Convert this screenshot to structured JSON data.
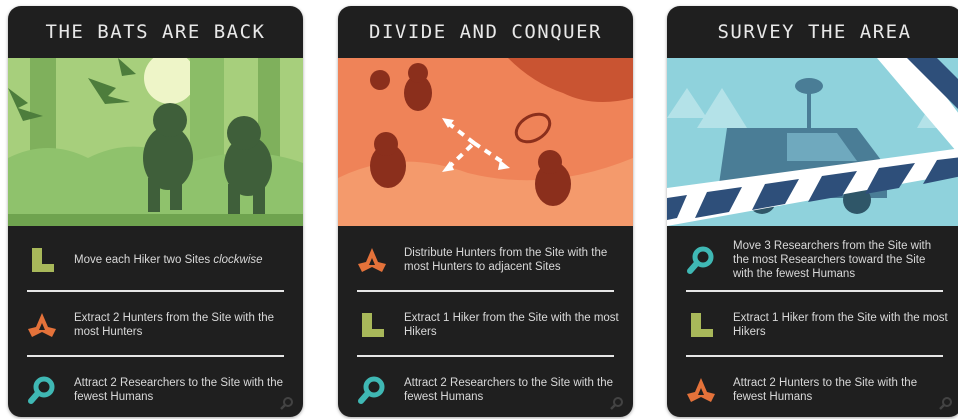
{
  "cards": [
    {
      "title": "THE BATS ARE BACK",
      "actions": [
        {
          "icon": "hiker-boot-icon",
          "text": "Move each Hiker two Sites ",
          "emphasis": "clockwise"
        },
        {
          "icon": "hunter-boomerang-icon",
          "text": "Extract 2 Hunters from the Site with the most Hunters"
        },
        {
          "icon": "researcher-magnifier-icon",
          "text": "Attract 2 Researchers to the Site with the fewest Humans"
        }
      ]
    },
    {
      "title": "DIVIDE AND CONQUER",
      "actions": [
        {
          "icon": "hunter-boomerang-icon",
          "text": "Distribute Hunters from the Site with the most Hunters to adjacent Sites"
        },
        {
          "icon": "hiker-boot-icon",
          "text": "Extract 1 Hiker from the Site with the most Hikers"
        },
        {
          "icon": "researcher-magnifier-icon",
          "text": "Attract 2 Researchers to the Site with the fewest Humans"
        }
      ]
    },
    {
      "title": "SURVEY THE AREA",
      "actions": [
        {
          "icon": "researcher-magnifier-icon",
          "text": "Move 3 Researchers from the Site with the most Researchers toward the Site with the fewest Humans"
        },
        {
          "icon": "hiker-boot-icon",
          "text": "Extract 1 Hiker from the Site with the most Hikers"
        },
        {
          "icon": "hunter-boomerang-icon",
          "text": "Attract 2 Hunters to the Site with the fewest Humans"
        }
      ]
    }
  ],
  "colors": {
    "card_bg": "#1f1f1f",
    "hiker": "#a8b85a",
    "hunter": "#e4723a",
    "researcher": "#3fb8b4",
    "forest": "#a7cf7c",
    "canyon": "#ef8358",
    "sky": "#8fd2dc"
  }
}
